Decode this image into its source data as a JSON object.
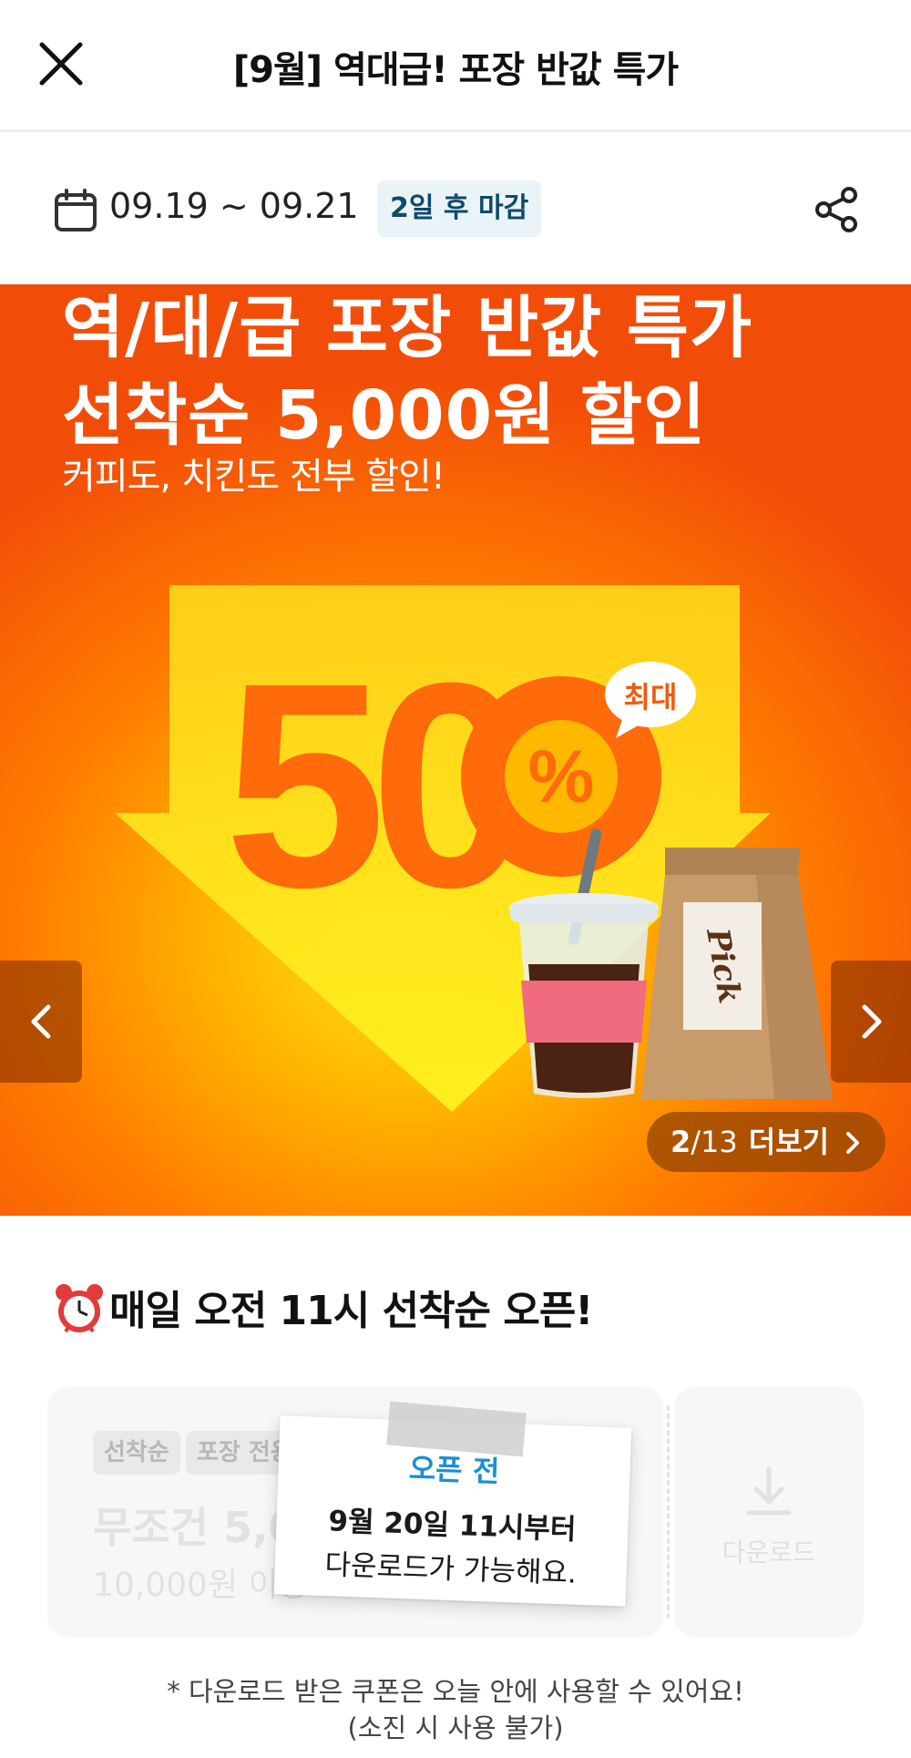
{
  "header": {
    "title": "[9월] 역대급! 포장 반값 특가",
    "close_icon": "close-icon"
  },
  "event": {
    "date_range": "09.19 ~ 09.21",
    "deadline": "2일 후 마감",
    "calendar_icon": "calendar-icon",
    "share_icon": "share-icon"
  },
  "banner": {
    "title_line1": "역/대/급 포장 반값 특가",
    "title_line2": "선착순 5,000원 할인",
    "subtitle": "커피도, 치킨도 전부 할인!",
    "big_number": "50",
    "percent": "%",
    "max_badge": "최대",
    "bag_label": "Pick",
    "pager_current": "2",
    "pager_total": "/13",
    "more_label": "더보기",
    "colors": {
      "orange": "#f24d08",
      "yellow": "#ffe21a"
    }
  },
  "section": {
    "title": "매일 오전 11시 선착순 오픈!",
    "icon": "alarm-clock-icon"
  },
  "coupon": {
    "tags": [
      "선착순",
      "포장 전용"
    ],
    "amount": "무조건 5,000원",
    "condition": "10,000원 이상",
    "download_label": "다운로드",
    "note": {
      "status": "오픈 전",
      "line1": "9월 20일 11시부터",
      "line2": "다운로드가 가능해요."
    }
  },
  "footnote": {
    "line1": "* 다운로드 받은 쿠폰은 오늘 안에 사용할 수 있어요!",
    "line2": "(소진 시 사용 불가)"
  }
}
